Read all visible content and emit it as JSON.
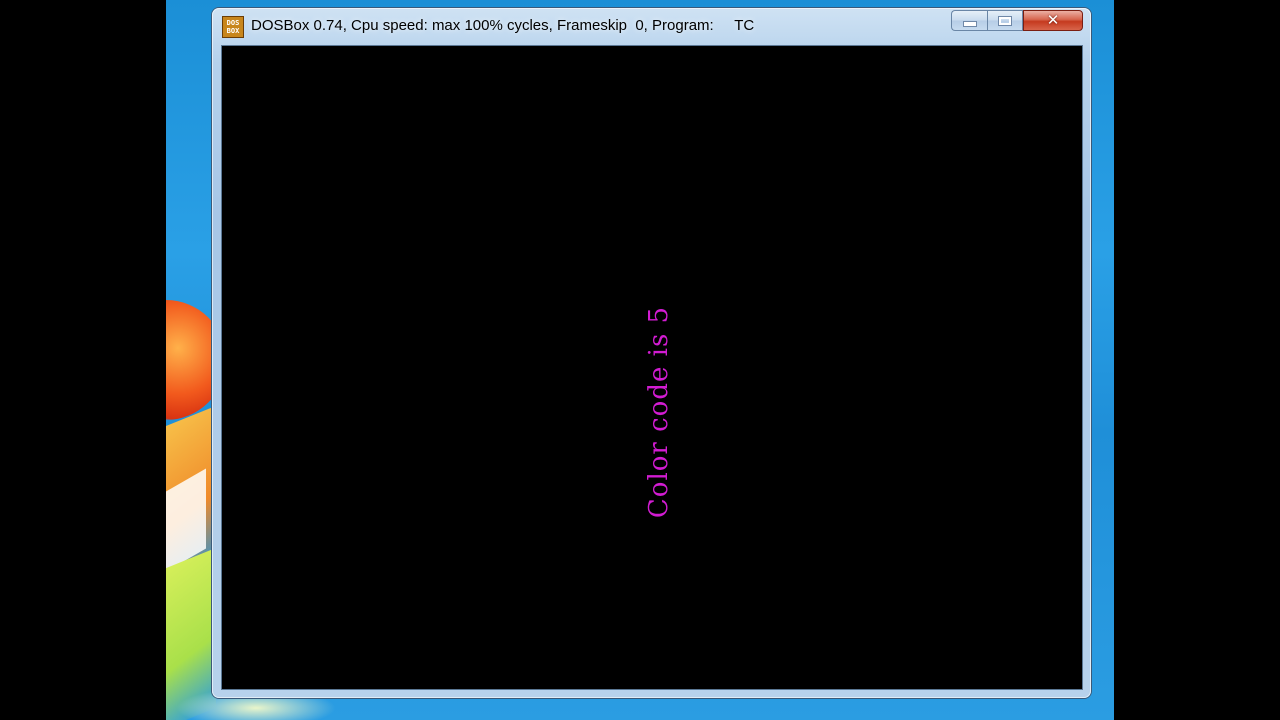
{
  "window": {
    "title": "DOSBox 0.74, Cpu speed: max 100% cycles, Frameskip  0, Program:     TC",
    "icon": {
      "name": "dosbox-icon",
      "label_top": "DOS",
      "label_bottom": "BOX"
    },
    "buttons": {
      "minimize": "minimize-icon",
      "maximize": "maximize-icon",
      "close": "close-icon"
    }
  },
  "screen": {
    "message": "Color code is 5",
    "message_color": "#d21cd2",
    "background": "#000000"
  },
  "desktop": {
    "accent": "#2aa0e6"
  }
}
